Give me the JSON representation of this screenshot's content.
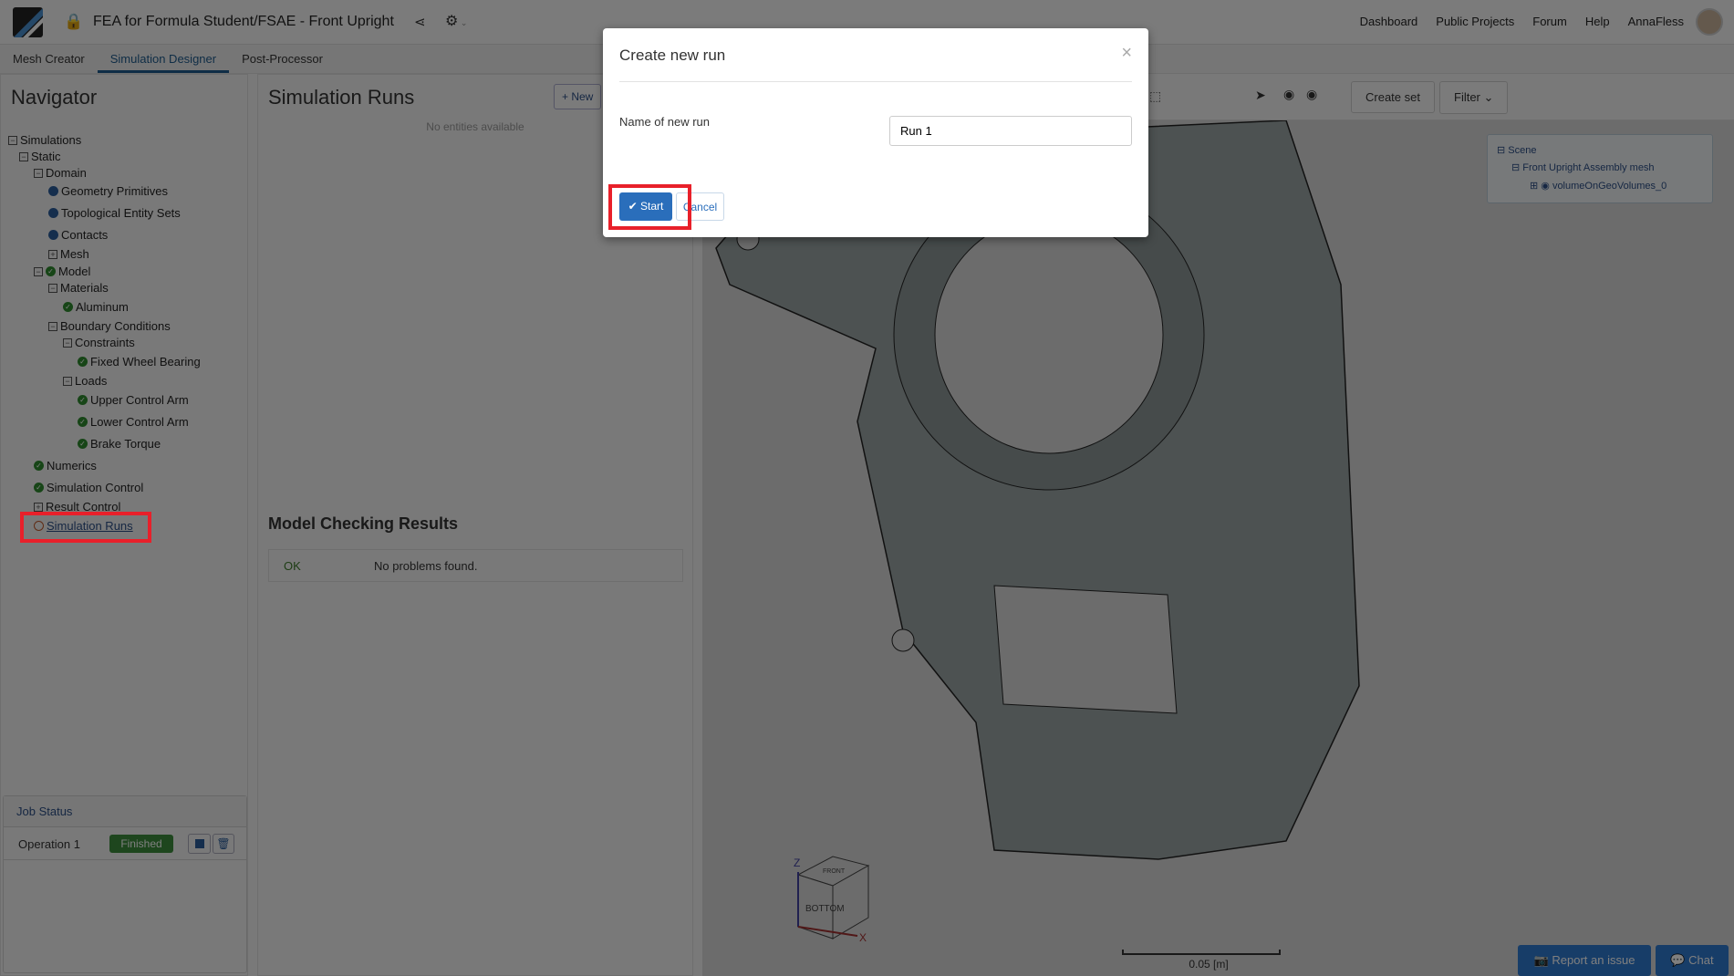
{
  "header": {
    "title": "FEA for Formula Student/FSAE - Front Upright",
    "nav": [
      "Dashboard",
      "Public Projects",
      "Forum",
      "Help",
      "AnnaFless"
    ]
  },
  "tabs": [
    "Mesh Creator",
    "Simulation Designer",
    "Post-Processor"
  ],
  "navigator": {
    "title": "Navigator",
    "tree": [
      {
        "label": "Simulations",
        "marker": "minus"
      },
      {
        "label": "Static",
        "marker": "minus"
      },
      {
        "label": "Domain",
        "marker": "minus"
      },
      {
        "label": "Geometry Primitives",
        "marker": "dot"
      },
      {
        "label": "Topological Entity Sets",
        "marker": "dot"
      },
      {
        "label": "Contacts",
        "marker": "dot"
      },
      {
        "label": "Mesh",
        "marker": "plus"
      },
      {
        "label": "Model",
        "marker": "minus-check"
      },
      {
        "label": "Materials",
        "marker": "minus"
      },
      {
        "label": "Aluminum",
        "marker": "check"
      },
      {
        "label": "Boundary Conditions",
        "marker": "minus"
      },
      {
        "label": "Constraints",
        "marker": "minus"
      },
      {
        "label": "Fixed Wheel Bearing",
        "marker": "check"
      },
      {
        "label": "Loads",
        "marker": "minus"
      },
      {
        "label": "Upper Control Arm",
        "marker": "check"
      },
      {
        "label": "Lower Control Arm",
        "marker": "check"
      },
      {
        "label": "Brake Torque",
        "marker": "check"
      },
      {
        "label": "Numerics",
        "marker": "check"
      },
      {
        "label": "Simulation Control",
        "marker": "check"
      },
      {
        "label": "Result Control",
        "marker": "plus"
      },
      {
        "label": "Simulation Runs",
        "marker": "ring"
      }
    ]
  },
  "job_status": {
    "title": "Job Status",
    "operation": "Operation 1",
    "status": "Finished"
  },
  "runs": {
    "title": "Simulation Runs",
    "new_label": "New",
    "empty": "No entities available",
    "check_title": "Model Checking Results",
    "check_status": "OK",
    "check_message": "No problems found."
  },
  "viewer": {
    "create_set": "Create set",
    "filter": "Filter",
    "scene": [
      "Scene",
      "Front Upright Assembly mesh",
      "volumeOnGeoVolumes_0"
    ],
    "scale": "0.05 [m]",
    "cube": {
      "front": "FRONT",
      "bottom": "BOTTOM",
      "z": "Z",
      "x": "X"
    }
  },
  "footer": {
    "report": "Report an issue",
    "chat": "Chat"
  },
  "dialog": {
    "title": "Create new run",
    "label": "Name of new run",
    "value": "Run 1",
    "start": "Start",
    "cancel": "Cancel"
  },
  "colors": {
    "accent": "#2a6ebb",
    "highlight": "#e8202a",
    "success": "#2e8b2e"
  }
}
